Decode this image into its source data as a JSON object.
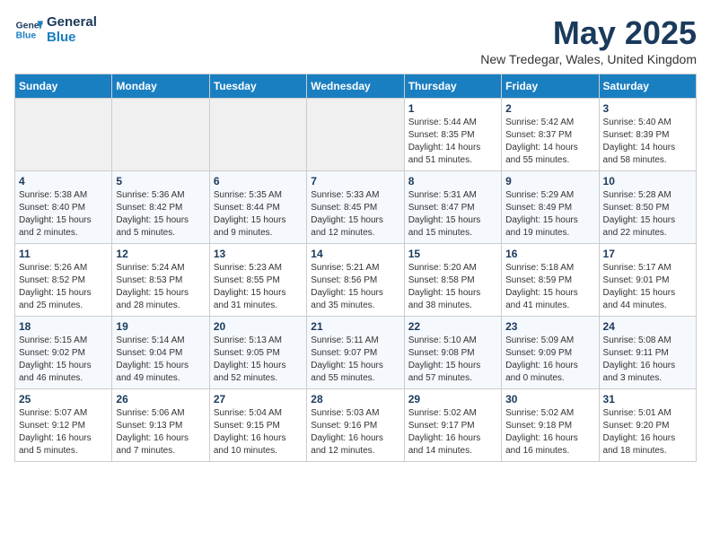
{
  "logo": {
    "line1": "General",
    "line2": "Blue"
  },
  "title": "May 2025",
  "subtitle": "New Tredegar, Wales, United Kingdom",
  "days": [
    "Sunday",
    "Monday",
    "Tuesday",
    "Wednesday",
    "Thursday",
    "Friday",
    "Saturday"
  ],
  "weeks": [
    [
      {
        "day": "",
        "info": ""
      },
      {
        "day": "",
        "info": ""
      },
      {
        "day": "",
        "info": ""
      },
      {
        "day": "",
        "info": ""
      },
      {
        "day": "1",
        "info": "Sunrise: 5:44 AM\nSunset: 8:35 PM\nDaylight: 14 hours\nand 51 minutes."
      },
      {
        "day": "2",
        "info": "Sunrise: 5:42 AM\nSunset: 8:37 PM\nDaylight: 14 hours\nand 55 minutes."
      },
      {
        "day": "3",
        "info": "Sunrise: 5:40 AM\nSunset: 8:39 PM\nDaylight: 14 hours\nand 58 minutes."
      }
    ],
    [
      {
        "day": "4",
        "info": "Sunrise: 5:38 AM\nSunset: 8:40 PM\nDaylight: 15 hours\nand 2 minutes."
      },
      {
        "day": "5",
        "info": "Sunrise: 5:36 AM\nSunset: 8:42 PM\nDaylight: 15 hours\nand 5 minutes."
      },
      {
        "day": "6",
        "info": "Sunrise: 5:35 AM\nSunset: 8:44 PM\nDaylight: 15 hours\nand 9 minutes."
      },
      {
        "day": "7",
        "info": "Sunrise: 5:33 AM\nSunset: 8:45 PM\nDaylight: 15 hours\nand 12 minutes."
      },
      {
        "day": "8",
        "info": "Sunrise: 5:31 AM\nSunset: 8:47 PM\nDaylight: 15 hours\nand 15 minutes."
      },
      {
        "day": "9",
        "info": "Sunrise: 5:29 AM\nSunset: 8:49 PM\nDaylight: 15 hours\nand 19 minutes."
      },
      {
        "day": "10",
        "info": "Sunrise: 5:28 AM\nSunset: 8:50 PM\nDaylight: 15 hours\nand 22 minutes."
      }
    ],
    [
      {
        "day": "11",
        "info": "Sunrise: 5:26 AM\nSunset: 8:52 PM\nDaylight: 15 hours\nand 25 minutes."
      },
      {
        "day": "12",
        "info": "Sunrise: 5:24 AM\nSunset: 8:53 PM\nDaylight: 15 hours\nand 28 minutes."
      },
      {
        "day": "13",
        "info": "Sunrise: 5:23 AM\nSunset: 8:55 PM\nDaylight: 15 hours\nand 31 minutes."
      },
      {
        "day": "14",
        "info": "Sunrise: 5:21 AM\nSunset: 8:56 PM\nDaylight: 15 hours\nand 35 minutes."
      },
      {
        "day": "15",
        "info": "Sunrise: 5:20 AM\nSunset: 8:58 PM\nDaylight: 15 hours\nand 38 minutes."
      },
      {
        "day": "16",
        "info": "Sunrise: 5:18 AM\nSunset: 8:59 PM\nDaylight: 15 hours\nand 41 minutes."
      },
      {
        "day": "17",
        "info": "Sunrise: 5:17 AM\nSunset: 9:01 PM\nDaylight: 15 hours\nand 44 minutes."
      }
    ],
    [
      {
        "day": "18",
        "info": "Sunrise: 5:15 AM\nSunset: 9:02 PM\nDaylight: 15 hours\nand 46 minutes."
      },
      {
        "day": "19",
        "info": "Sunrise: 5:14 AM\nSunset: 9:04 PM\nDaylight: 15 hours\nand 49 minutes."
      },
      {
        "day": "20",
        "info": "Sunrise: 5:13 AM\nSunset: 9:05 PM\nDaylight: 15 hours\nand 52 minutes."
      },
      {
        "day": "21",
        "info": "Sunrise: 5:11 AM\nSunset: 9:07 PM\nDaylight: 15 hours\nand 55 minutes."
      },
      {
        "day": "22",
        "info": "Sunrise: 5:10 AM\nSunset: 9:08 PM\nDaylight: 15 hours\nand 57 minutes."
      },
      {
        "day": "23",
        "info": "Sunrise: 5:09 AM\nSunset: 9:09 PM\nDaylight: 16 hours\nand 0 minutes."
      },
      {
        "day": "24",
        "info": "Sunrise: 5:08 AM\nSunset: 9:11 PM\nDaylight: 16 hours\nand 3 minutes."
      }
    ],
    [
      {
        "day": "25",
        "info": "Sunrise: 5:07 AM\nSunset: 9:12 PM\nDaylight: 16 hours\nand 5 minutes."
      },
      {
        "day": "26",
        "info": "Sunrise: 5:06 AM\nSunset: 9:13 PM\nDaylight: 16 hours\nand 7 minutes."
      },
      {
        "day": "27",
        "info": "Sunrise: 5:04 AM\nSunset: 9:15 PM\nDaylight: 16 hours\nand 10 minutes."
      },
      {
        "day": "28",
        "info": "Sunrise: 5:03 AM\nSunset: 9:16 PM\nDaylight: 16 hours\nand 12 minutes."
      },
      {
        "day": "29",
        "info": "Sunrise: 5:02 AM\nSunset: 9:17 PM\nDaylight: 16 hours\nand 14 minutes."
      },
      {
        "day": "30",
        "info": "Sunrise: 5:02 AM\nSunset: 9:18 PM\nDaylight: 16 hours\nand 16 minutes."
      },
      {
        "day": "31",
        "info": "Sunrise: 5:01 AM\nSunset: 9:20 PM\nDaylight: 16 hours\nand 18 minutes."
      }
    ]
  ]
}
